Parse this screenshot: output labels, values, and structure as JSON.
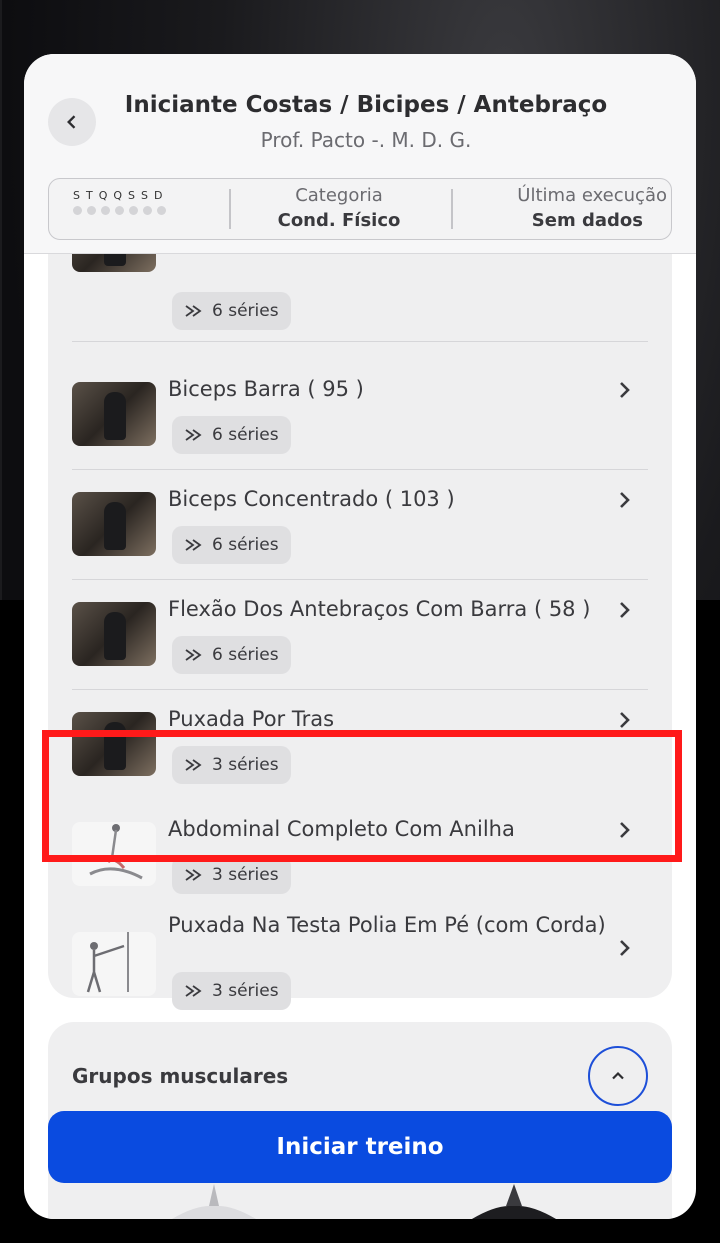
{
  "header": {
    "title": "Iniciante Costas / Bicipes / Antebraço",
    "subtitle": "Prof. Pacto -. M. D. G.",
    "days": "STQQSSD",
    "category_label": "Categoria",
    "category_value": "Cond. Físico",
    "last_label": "Última execução",
    "last_value": "Sem dados"
  },
  "exercises": [
    {
      "name": "",
      "series": "6 séries"
    },
    {
      "name": "Biceps Barra  ( 95 )",
      "series": "6 séries"
    },
    {
      "name": "Biceps Concentrado ( 103 )",
      "series": "6 séries"
    },
    {
      "name": "Flexão Dos Antebraços Com Barra ( 58 )",
      "series": "6 séries"
    },
    {
      "name": "Puxada Por Tras",
      "series": "3 séries"
    },
    {
      "name": "Abdominal Completo Com Anilha",
      "series": "3 séries"
    },
    {
      "name": "Puxada Na Testa Polia Em Pé (com Corda)",
      "series": "3 séries"
    }
  ],
  "groups": {
    "title": "Grupos musculares"
  },
  "actions": {
    "start_label": "Iniciar treino"
  },
  "colors": {
    "primary": "#0a4be0",
    "highlight": "#ff1a1a"
  }
}
